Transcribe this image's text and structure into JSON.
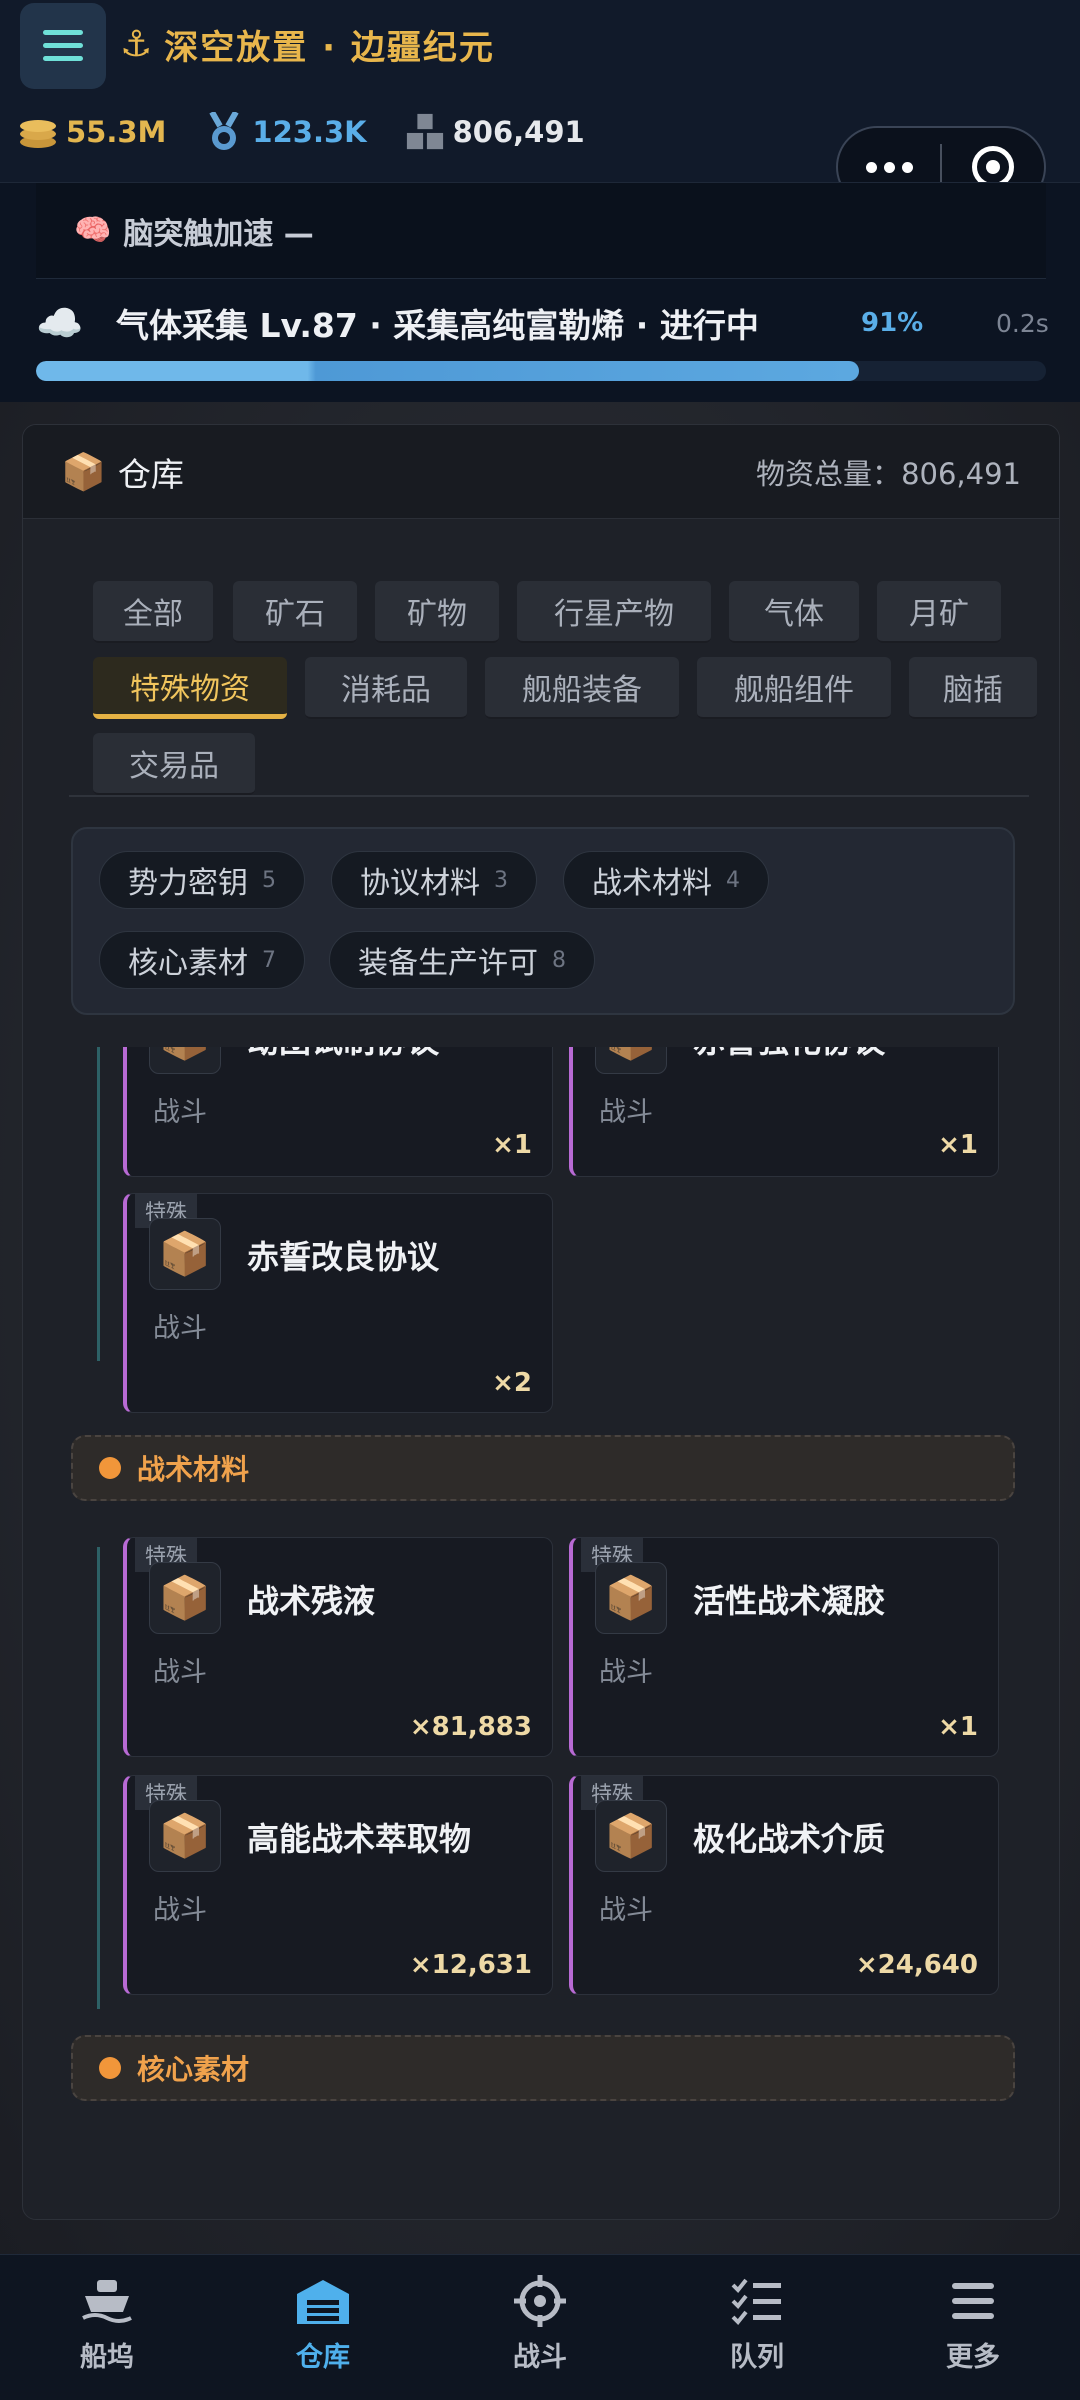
{
  "header": {
    "app_title": "深空放置 · 边疆纪元",
    "resources": [
      {
        "name": "coins",
        "value": "55.3M"
      },
      {
        "name": "medal",
        "value": "123.3K"
      },
      {
        "name": "materials",
        "value": "806,491"
      }
    ]
  },
  "status": {
    "boost_label": "脑突触加速 —",
    "task_text": "气体采集 Lv.87 · 采集高纯富勒烯 · 进行中",
    "task_percent_text": "91%",
    "task_time": "0.2s",
    "progress": 0.815
  },
  "warehouse": {
    "title": "仓库",
    "total_label": "物资总量：",
    "total_value": "806,491",
    "tabs": [
      "全部",
      "矿石",
      "矿物",
      "行星产物",
      "气体",
      "月矿",
      "特殊物资",
      "消耗品",
      "舰船装备",
      "舰船组件",
      "脑插",
      "交易品"
    ],
    "active_tab": "特殊物资",
    "subcategories": [
      {
        "label": "势力密钥",
        "count": "5"
      },
      {
        "label": "协议材料",
        "count": "3"
      },
      {
        "label": "战术材料",
        "count": "4"
      },
      {
        "label": "核心素材",
        "count": "7"
      },
      {
        "label": "装备生产许可",
        "count": "8"
      }
    ],
    "protocol_items": [
      {
        "tag": "",
        "name": "劫团试制协议",
        "sub": "战斗",
        "qty": "×1"
      },
      {
        "tag": "",
        "name": "赤誓强化协议",
        "sub": "战斗",
        "qty": "×1"
      },
      {
        "tag": "特殊",
        "name": "赤誓改良协议",
        "sub": "战斗",
        "qty": "×2"
      }
    ],
    "tactical_group": "战术材料",
    "tactical_items": [
      {
        "tag": "特殊",
        "name": "战术残液",
        "sub": "战斗",
        "qty": "×81,883"
      },
      {
        "tag": "特殊",
        "name": "活性战术凝胶",
        "sub": "战斗",
        "qty": "×1"
      },
      {
        "tag": "特殊",
        "name": "高能战术萃取物",
        "sub": "战斗",
        "qty": "×12,631"
      },
      {
        "tag": "特殊",
        "name": "极化战术介质",
        "sub": "战斗",
        "qty": "×24,640"
      }
    ],
    "core_group": "核心素材"
  },
  "nav": {
    "items": [
      "船坞",
      "仓库",
      "战斗",
      "队列",
      "更多"
    ],
    "active": "仓库"
  },
  "colors": {
    "accent_gold": "#e5b244",
    "accent_blue": "#4fb0ec",
    "card_border": "#b86ad4",
    "group_orange": "#f1963a"
  }
}
